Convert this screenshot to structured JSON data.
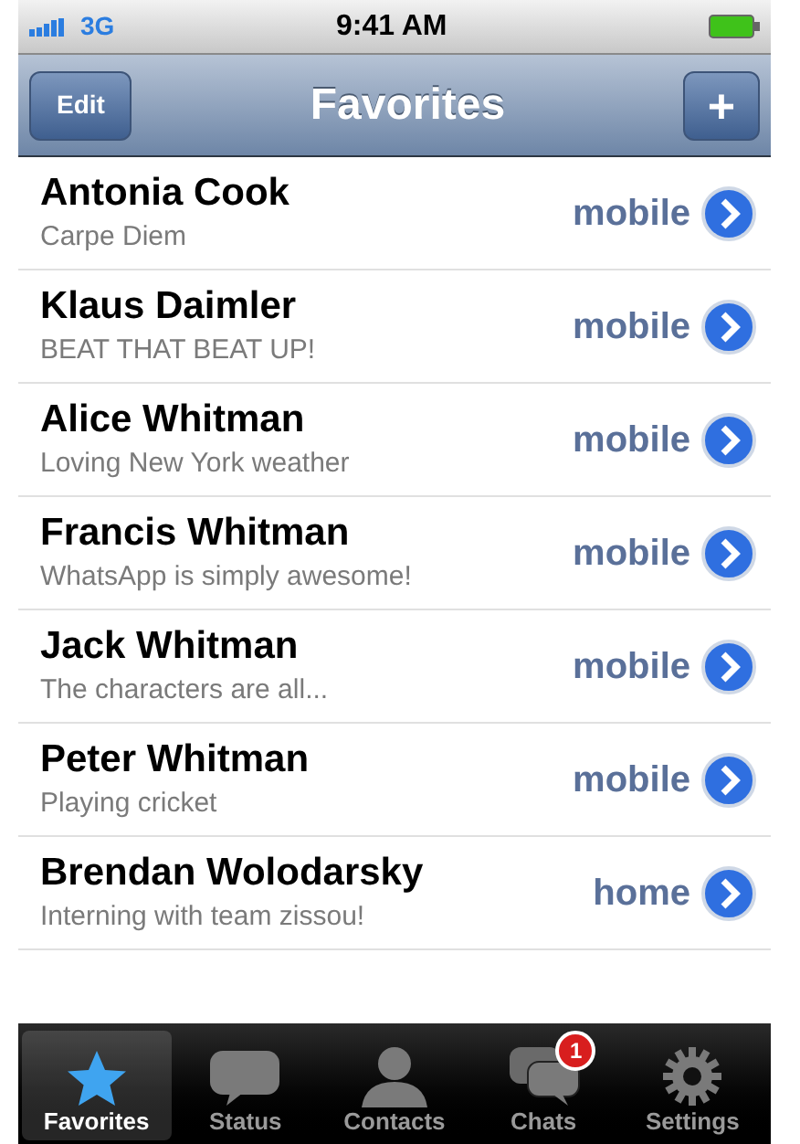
{
  "status_bar": {
    "carrier": "3G",
    "time": "9:41 AM"
  },
  "nav_bar": {
    "left_button": "Edit",
    "title": "Favorites",
    "right_button": "+"
  },
  "contacts": [
    {
      "name": "Antonia Cook",
      "status": "Carpe Diem",
      "phone_type": "mobile"
    },
    {
      "name": "Klaus Daimler",
      "status": "BEAT THAT BEAT UP!",
      "phone_type": "mobile"
    },
    {
      "name": "Alice Whitman",
      "status": "Loving New York weather",
      "phone_type": "mobile"
    },
    {
      "name": "Francis Whitman",
      "status": "WhatsApp is simply awesome!",
      "phone_type": "mobile"
    },
    {
      "name": "Jack Whitman",
      "status": "The characters are all...",
      "phone_type": "mobile"
    },
    {
      "name": "Peter Whitman",
      "status": "Playing cricket",
      "phone_type": "mobile"
    },
    {
      "name": "Brendan Wolodarsky",
      "status": "Interning with team zissou!",
      "phone_type": "home"
    }
  ],
  "tab_bar": [
    {
      "kind": "star",
      "label": "Favorites",
      "selected": true
    },
    {
      "kind": "bubble",
      "label": "Status",
      "selected": false
    },
    {
      "kind": "person",
      "label": "Contacts",
      "selected": false
    },
    {
      "kind": "bubbles",
      "label": "Chats",
      "selected": false,
      "badge": "1"
    },
    {
      "kind": "gear",
      "label": "Settings",
      "selected": false
    }
  ]
}
